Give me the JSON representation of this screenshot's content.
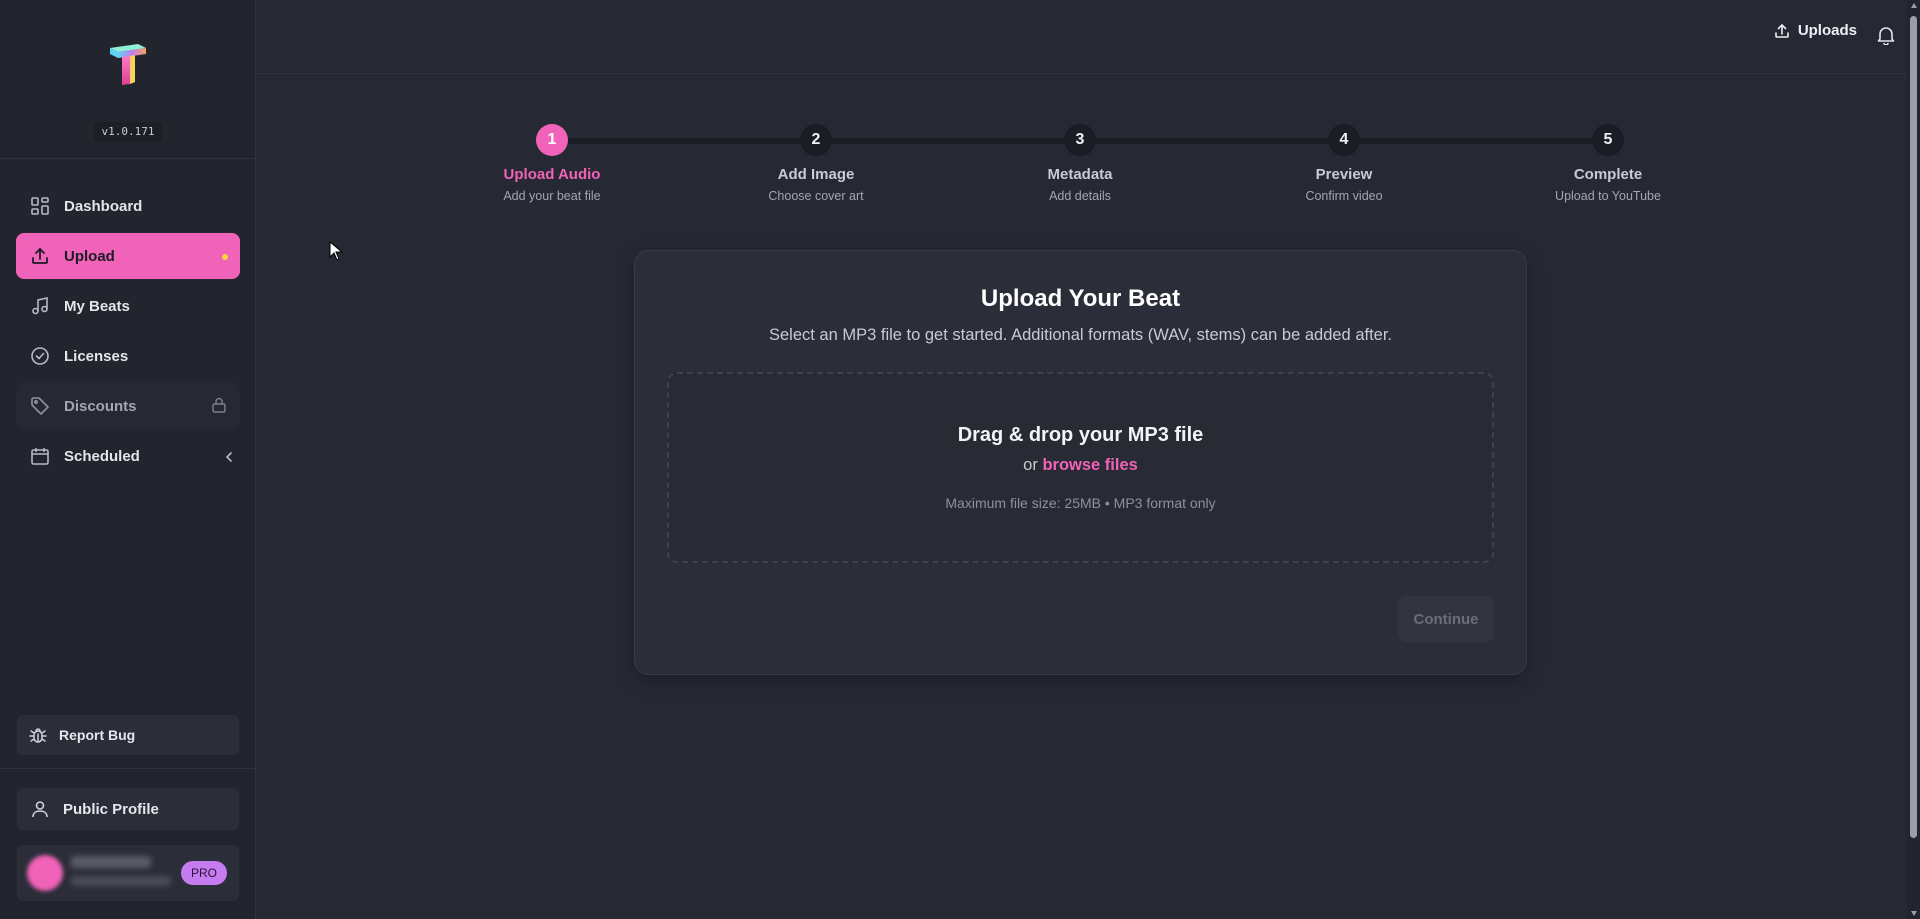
{
  "app": {
    "version": "v1.0.171"
  },
  "sidebar": {
    "items": [
      {
        "label": "Dashboard",
        "icon": "dashboard-icon"
      },
      {
        "label": "Upload",
        "icon": "upload-icon",
        "active": true
      },
      {
        "label": "My Beats",
        "icon": "music-note-icon"
      },
      {
        "label": "Licenses",
        "icon": "check-circle-icon"
      },
      {
        "label": "Discounts",
        "icon": "tag-icon",
        "locked": true
      },
      {
        "label": "Scheduled",
        "icon": "calendar-icon"
      }
    ],
    "report_bug": "Report Bug",
    "public_profile": "Public Profile",
    "user": {
      "badge": "PRO"
    }
  },
  "topbar": {
    "uploads_label": "Uploads"
  },
  "stepper": {
    "steps": [
      {
        "num": "1",
        "title": "Upload Audio",
        "sub": "Add your beat file",
        "active": true
      },
      {
        "num": "2",
        "title": "Add Image",
        "sub": "Choose cover art"
      },
      {
        "num": "3",
        "title": "Metadata",
        "sub": "Add details"
      },
      {
        "num": "4",
        "title": "Preview",
        "sub": "Confirm video"
      },
      {
        "num": "5",
        "title": "Complete",
        "sub": "Upload to YouTube"
      }
    ]
  },
  "card": {
    "title": "Upload Your Beat",
    "subtitle": "Select an MP3 file to get started. Additional formats (WAV, stems) can be added after.",
    "dropzone": {
      "title": "Drag & drop your MP3 file",
      "or": "or",
      "browse": "browse files",
      "hint": "Maximum file size: 25MB • MP3 format only"
    },
    "continue_label": "Continue"
  },
  "colors": {
    "accent": "#f063b8",
    "background": "#262833",
    "sidebar": "#22242e",
    "pro_badge": "#c57cf0"
  }
}
